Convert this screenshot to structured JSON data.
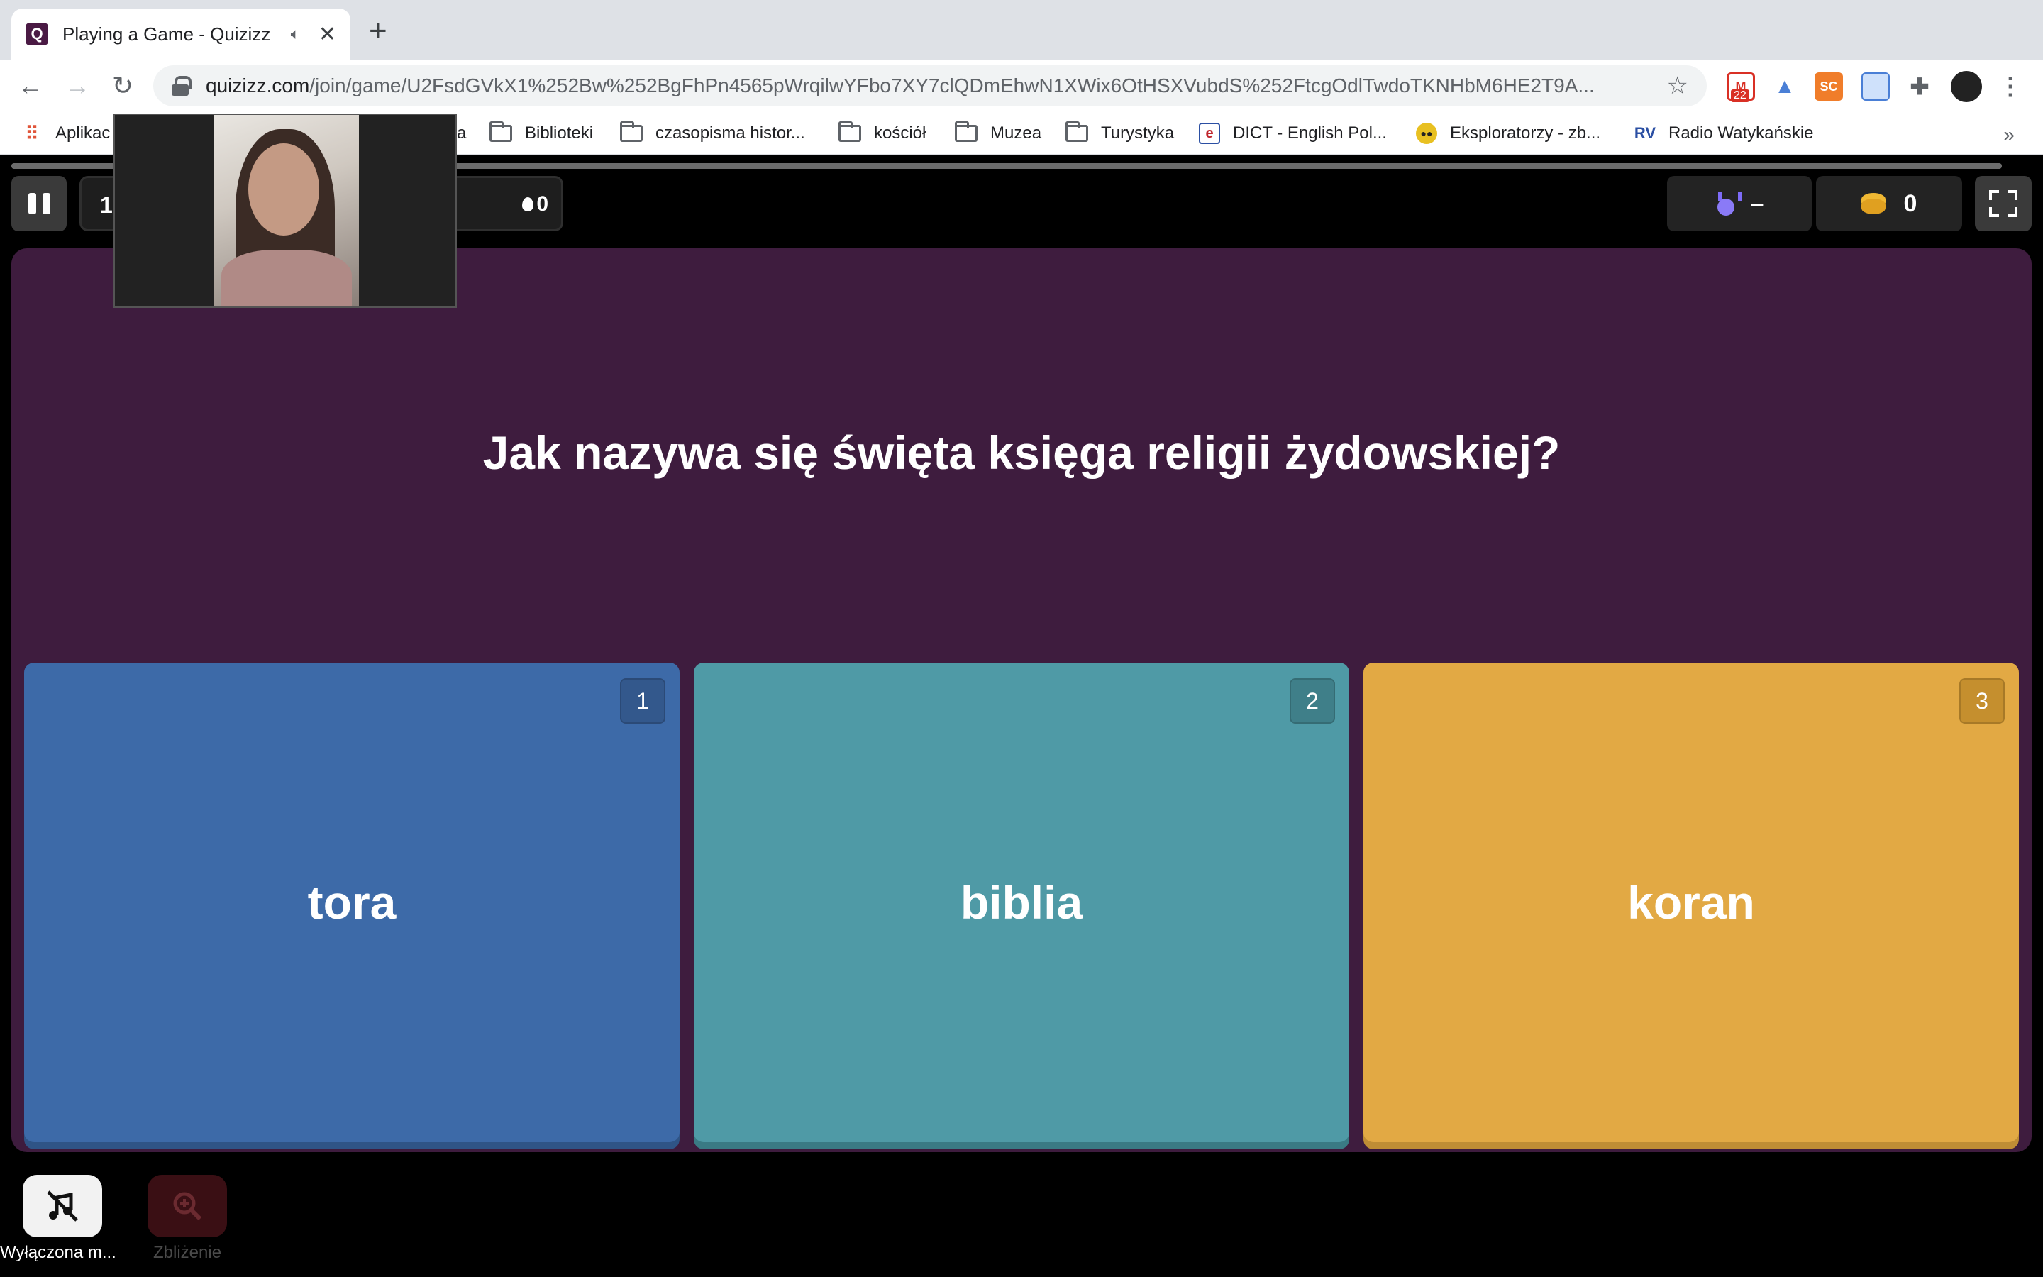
{
  "browser": {
    "tab_title": "Playing a Game - Quizizz",
    "url_host": "quizizz.com",
    "url_path": "/join/game/U2FsdGVkX1%252Bw%252BgFhPn4565pWrqilwYFbo7XY7clQDmEhwN1XWix6OtHSXVubdS%252FtcgOdlTwdoTKNHbM6HE2T9A...",
    "gmail_badge": "22",
    "ext_sc_label": "SC"
  },
  "bookmarks": [
    {
      "label": "Aplikac",
      "icon": "apps-grid-icon"
    },
    {
      "label": "a",
      "icon": "none"
    },
    {
      "label": "Biblioteki",
      "icon": "folder-icon"
    },
    {
      "label": "czasopisma histor...",
      "icon": "folder-icon"
    },
    {
      "label": "kościół",
      "icon": "folder-icon"
    },
    {
      "label": "Muzea",
      "icon": "folder-icon"
    },
    {
      "label": "Turystyka",
      "icon": "folder-icon"
    },
    {
      "label": "DICT - English Pol...",
      "icon": "dict-icon"
    },
    {
      "label": "Eksploratorzy - zb...",
      "icon": "goggles-icon"
    },
    {
      "label": "Radio Watykańskie",
      "icon": "radio-icon"
    }
  ],
  "game": {
    "question_counter": "1/",
    "streak": "0",
    "rank": "–",
    "coins": "0",
    "question": "Jak nazywa się święta księga religii żydowskiej?",
    "answers": [
      {
        "number": "1",
        "text": "tora",
        "color": "#3d6aa8",
        "badge_color": "#33588c",
        "shadow": "#2f5486"
      },
      {
        "number": "2",
        "text": "biblia",
        "color": "#4f9aa6",
        "badge_color": "#3f7f89",
        "shadow": "#3a7a84"
      },
      {
        "number": "3",
        "text": "koran",
        "color": "#e2a944",
        "badge_color": "#c58f2e",
        "shadow": "#bf8d35"
      }
    ],
    "panel_color": "#3e1c3e"
  },
  "bottom": {
    "music_label": "Wyłączona m...",
    "zoom_label": "Zbliżenie"
  }
}
